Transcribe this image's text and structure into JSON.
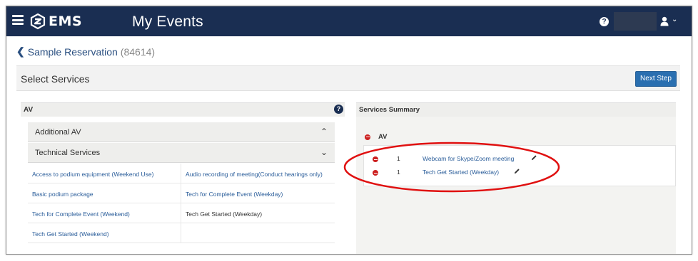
{
  "header": {
    "logo_text": "EMS",
    "title": "My Events",
    "help_icon": "question-circle-icon",
    "user_icon": "user-icon",
    "colors": {
      "bar": "#1a2e52"
    }
  },
  "breadcrumb": {
    "name": "Sample Reservation",
    "id": "(84614)"
  },
  "select_services": {
    "title": "Select Services",
    "next_button": "Next Step"
  },
  "av_panel": {
    "title": "AV",
    "accordions": [
      {
        "label": "Additional AV",
        "state": "expanded"
      },
      {
        "label": "Technical Services",
        "state": "collapsed"
      }
    ],
    "services": [
      [
        "Access to podium equipment (Weekend Use)",
        "Audio recording of meeting(Conduct hearings only)"
      ],
      [
        "Basic podium package",
        "Tech for Complete Event (Weekday)"
      ],
      [
        "Tech for Complete Event (Weekend)",
        "Tech Get Started (Weekday)"
      ],
      [
        "Tech Get Started (Weekend)",
        ""
      ]
    ]
  },
  "summary": {
    "title": "Services Summary",
    "group": "AV",
    "items": [
      {
        "qty": "1",
        "name": "Webcam for Skype/Zoom meeting"
      },
      {
        "qty": "1",
        "name": "Tech Get Started (Weekday)"
      }
    ]
  }
}
